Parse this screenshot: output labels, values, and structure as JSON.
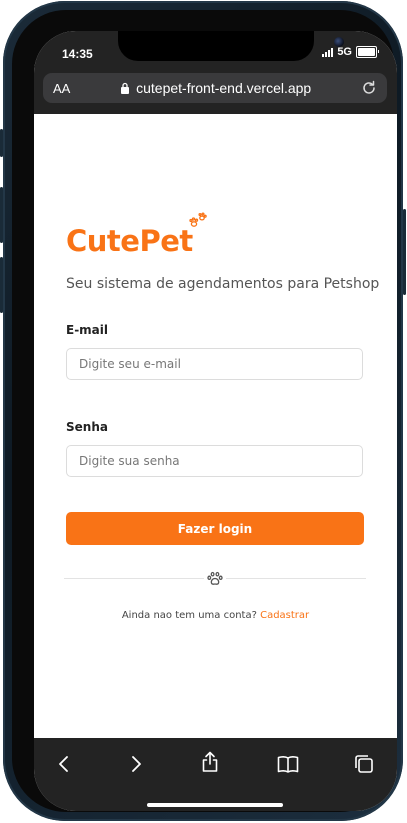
{
  "status_bar": {
    "time": "14:35",
    "network": "5G"
  },
  "browser": {
    "text_size_label": "AA",
    "url": "cutepet-front-end.vercel.app"
  },
  "login": {
    "brand": "CutePet",
    "tagline": "Seu sistema de agendamentos para Petshop",
    "email_label": "E-mail",
    "email_placeholder": "Digite seu e-mail",
    "password_label": "Senha",
    "password_placeholder": "Digite sua senha",
    "submit_label": "Fazer login",
    "signup_prompt": "Ainda nao tem uma conta?",
    "signup_link": "Cadastrar"
  },
  "theme": {
    "accent": "#f97316"
  },
  "icons": [
    "lock-icon",
    "reload-icon",
    "paws-icon",
    "paw-icon",
    "back-icon",
    "forward-icon",
    "share-icon",
    "bookmarks-icon",
    "tabs-icon"
  ]
}
